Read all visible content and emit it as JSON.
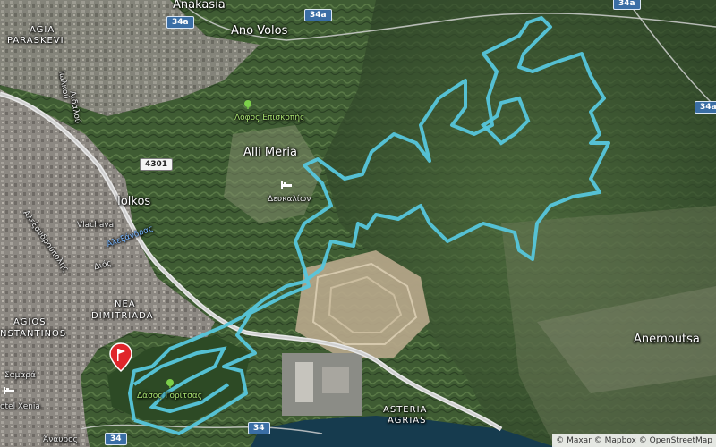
{
  "map": {
    "colors": {
      "terrain": "#3d5a33",
      "town": "#8a8680",
      "track": "#56c6dc",
      "road": "#e8e8e8",
      "sea": "#163b4e",
      "quarry": "#b9a98c",
      "pin": "#e0262b"
    },
    "labels": {
      "anakasia": "Anakasia",
      "ano_volos": "Ano Volos",
      "agia_paraskevi_1": "AGIA",
      "agia_paraskevi_2": "PARASKEVI",
      "lofos_episkopis": "Λόφος Επισκοπής",
      "alli_meria": "Alli Meria",
      "deukalion": "Δευκαλίων",
      "iolkos": "Iolkos",
      "vlachava": "Vlachava",
      "alexandras": "Αλεξάνδρας",
      "dios": "Διός",
      "nea_dimitriada_1": "NEA",
      "nea_dimitriada_2": "DIMITRIADA",
      "agios_konstantinos_1": "AGIOS",
      "agios_konstantinos_2": "NSTANTINOS",
      "dasos_gorizas": "Δάσος Γορίτσας",
      "hotel_xenia": "otel Xenia",
      "asteria_agrias_1": "ASTERIA",
      "asteria_agrias_2": "AGRIAS",
      "anemoutsa": "Anemoutsa",
      "anavros": "Άναυρος",
      "street_1": "Ιωλκού",
      "street_2": "Αιδαλού",
      "street_3": "Αλεξανδρούπολης",
      "street_4": "Σαμαρά"
    },
    "shields": {
      "s34a_top": "34a",
      "s34a_top2": "34a",
      "s34a_top3": "34a",
      "s34a_right": "34a",
      "s4301": "4301",
      "s34_bottom": "34",
      "s34_bottom2": "34"
    },
    "icons": {
      "pin": "flag-pin-icon",
      "tree1": "park-tree-icon",
      "tree2": "park-tree-icon",
      "lodging": "bed-icon"
    },
    "attribution": "© Maxar © Mapbox © OpenStreetMap"
  }
}
